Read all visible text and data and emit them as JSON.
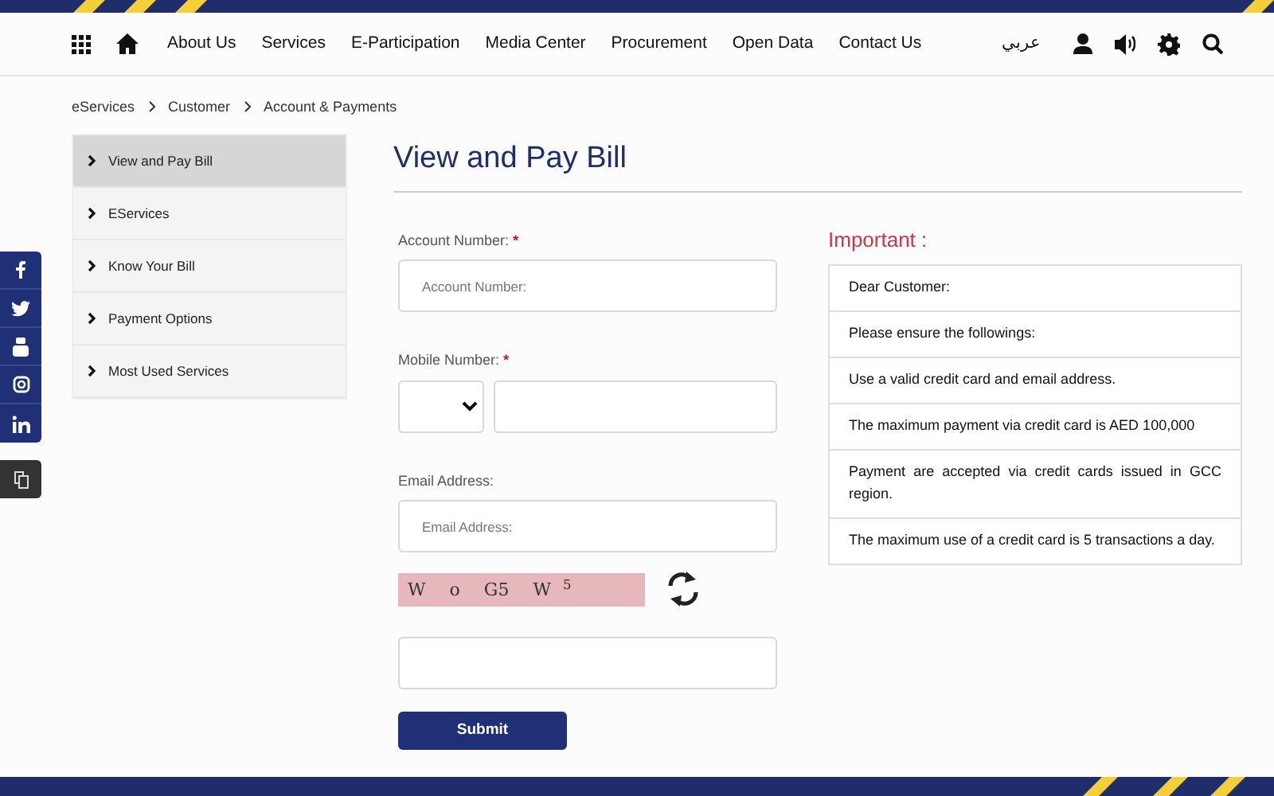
{
  "nav": {
    "items": [
      "About Us",
      "Services",
      "E-Participation",
      "Media Center",
      "Procurement",
      "Open Data",
      "Contact Us"
    ],
    "language": "عربي"
  },
  "breadcrumb": [
    "eServices",
    "Customer",
    "Account & Payments"
  ],
  "sidebar": {
    "items": [
      {
        "label": "View and Pay Bill",
        "selected": true
      },
      {
        "label": "EServices",
        "selected": false
      },
      {
        "label": "Know Your Bill",
        "selected": false
      },
      {
        "label": "Payment Options",
        "selected": false
      },
      {
        "label": "Most Used Services",
        "selected": false
      }
    ]
  },
  "page_title": "View and Pay Bill",
  "form": {
    "fields": [
      {
        "kind": "text",
        "label": "Account Number:",
        "required_mark": "*",
        "placeholder": "Account Number:"
      },
      {
        "kind": "phone",
        "label": "Mobile Number:",
        "required_mark": "*"
      },
      {
        "kind": "text",
        "label": "Email Address:",
        "placeholder": "Email Address:"
      }
    ],
    "captcha": {
      "text": "W  o  G5  W $^{5}$"
    },
    "submit": "Submit"
  },
  "important": {
    "title": "Important :",
    "items": [
      "Dear Customer:",
      "Please ensure the followings:",
      "Use a valid credit card and email address.",
      "The maximum payment via credit card is AED 100,000",
      "Payment are accepted via credit cards issued in GCC region.",
      "The maximum use of a credit card is 5 transactions a day."
    ]
  }
}
